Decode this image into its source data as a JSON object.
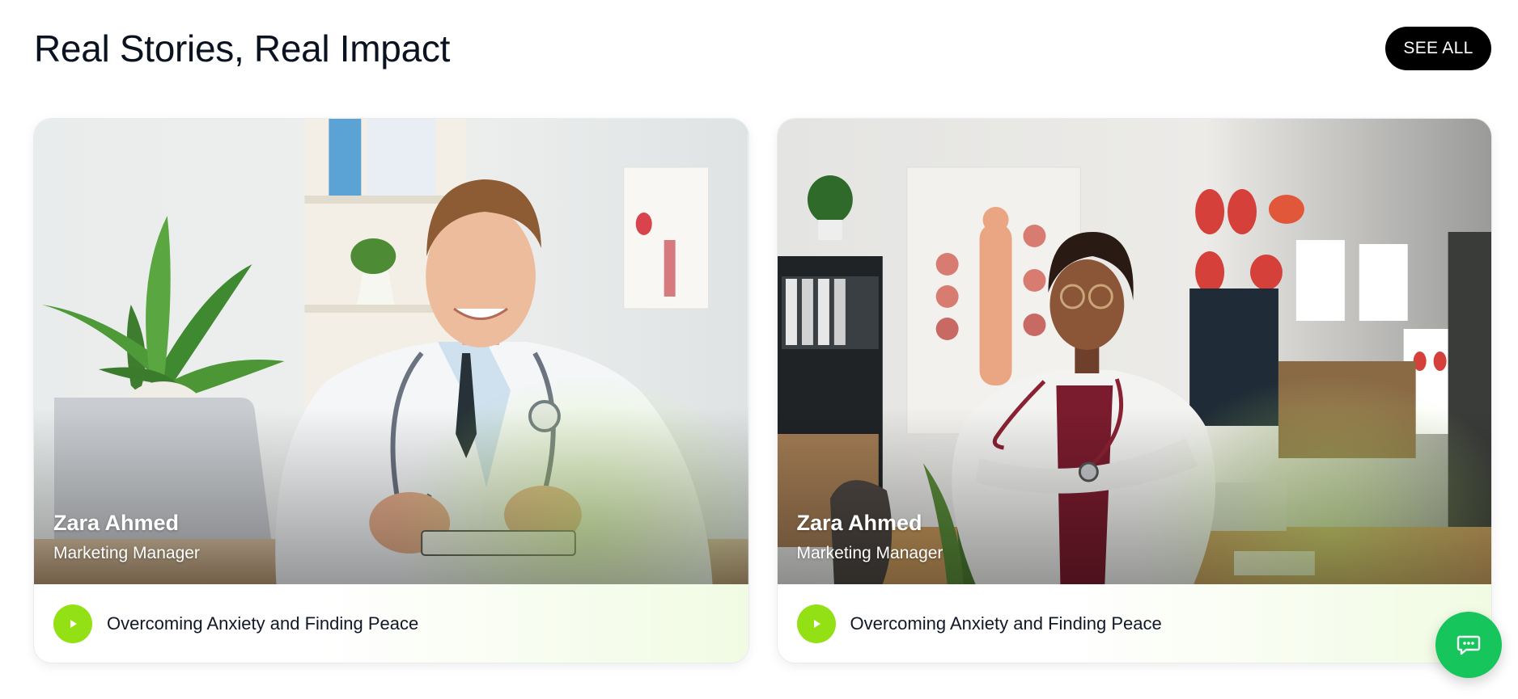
{
  "section": {
    "title": "Real Stories, Real Impact",
    "see_all_label": "SEE ALL"
  },
  "cards": [
    {
      "name": "Zara Ahmed",
      "role": "Marketing Manager",
      "story_title": "Overcoming Anxiety and Finding Peace",
      "photo": "male-doctor-at-desk-with-laptop",
      "play_icon": "play-icon"
    },
    {
      "name": "Zara Ahmed",
      "role": "Marketing Manager",
      "story_title": "Overcoming Anxiety and Finding Peace",
      "photo": "female-doctor-arms-crossed-in-clinic",
      "play_icon": "play-icon"
    }
  ],
  "chat_button": {
    "icon": "chat-icon"
  },
  "colors": {
    "play_button": "#93e014",
    "chat_button": "#16c55b",
    "see_all_bg": "#000000"
  }
}
